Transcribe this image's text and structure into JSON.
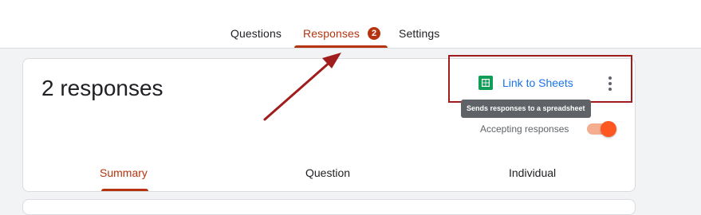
{
  "tabs": [
    {
      "label": "Questions"
    },
    {
      "label": "Responses",
      "badge": "2",
      "active": true
    },
    {
      "label": "Settings"
    }
  ],
  "summary": {
    "response_count_label": "2 responses",
    "link_to_sheets_label": "Link to Sheets",
    "link_to_sheets_icon": "google-sheets-icon",
    "more_icon": "more-vert-icon",
    "tooltip": "Sends responses to a spreadsheet",
    "accepting_label": "Accepting responses",
    "accepting_on": true
  },
  "subtabs": [
    {
      "label": "Summary",
      "active": true
    },
    {
      "label": "Question"
    },
    {
      "label": "Individual"
    }
  ],
  "colors": {
    "accent": "#b5340f",
    "link": "#1a73e8",
    "toggle_on": "#ff5722",
    "annotation": "#a11d1d",
    "sheets_green": "#0f9d58"
  }
}
